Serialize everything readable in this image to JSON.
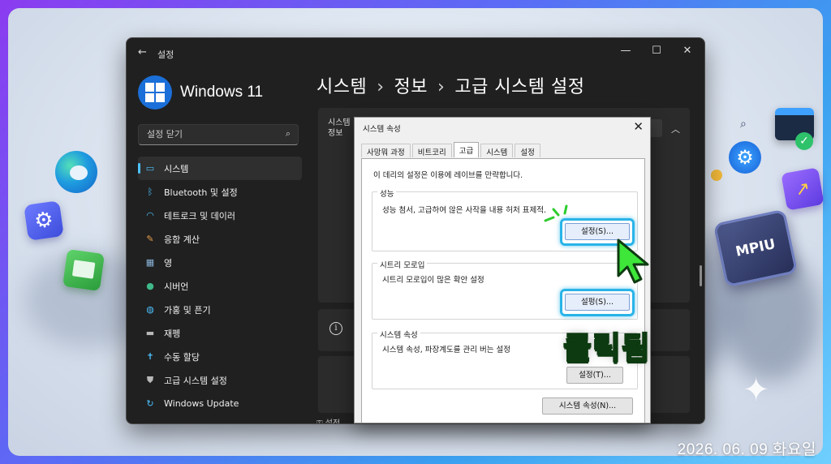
{
  "window": {
    "title": "설정",
    "brand": "Windows 11",
    "controls": [
      "—",
      "☐",
      "✕"
    ]
  },
  "search": {
    "placeholder": "설정 닫기"
  },
  "sidebar": {
    "items": [
      {
        "label": "시스템",
        "icon": "monitor-icon",
        "color": "#4cc2ff"
      },
      {
        "label": "Bluetooth 및 설정",
        "icon": "bluetooth-icon",
        "color": "#4cc2ff"
      },
      {
        "label": "테트로크 및 데이러",
        "icon": "wifi-icon",
        "color": "#4cc2ff"
      },
      {
        "label": "응함 계산",
        "icon": "brush-icon",
        "color": "#e8a04c"
      },
      {
        "label": "영",
        "icon": "apps-icon",
        "color": "#8ab4d8"
      },
      {
        "label": "시버언",
        "icon": "person-icon",
        "color": "#3fb98a"
      },
      {
        "label": "가홍 및 픈기",
        "icon": "globe-icon",
        "color": "#4cc2ff"
      },
      {
        "label": "재펭",
        "icon": "gamepad-icon",
        "color": "#b8b8b8"
      },
      {
        "label": "수동 할당",
        "icon": "accessibility-icon",
        "color": "#4cc2ff"
      },
      {
        "label": "고급 시스템 설정",
        "icon": "shield-icon",
        "color": "#b8b8b8"
      },
      {
        "label": "Windows Update",
        "icon": "update-icon",
        "color": "#4cc2ff"
      }
    ]
  },
  "breadcrumb": {
    "part1": "시스템",
    "part2": "정보",
    "part3": "고급 시스템 설정",
    "sep": "›"
  },
  "panel": {
    "label_line1": "시스템",
    "label_line2": "정보"
  },
  "footer_partial": "설정",
  "dialog": {
    "title": "시스템 속성",
    "tabs": [
      "사망뭐 과정",
      "비트코리",
      "고급",
      "시스템",
      "설정"
    ],
    "active_tab": "고급",
    "intro": "이 데리의 설정은 이용에 레이브를 만략합니다.",
    "groups": [
      {
        "title": "성능",
        "desc": "성능 첨서, 고급하여 않은 사작을 내용 허처 표제적.",
        "button": "설정(S)..."
      },
      {
        "title": "시트리 모로입",
        "desc": "시트리 모로입이 많은 확안 설정",
        "button": "설펑(S)..."
      },
      {
        "title": "시스템 속성",
        "desc": "시스템 속성, 파장계도를 관리 버는 설정",
        "button": "설정(T)..."
      }
    ],
    "bottom_button": "시스템 속성(N)..."
  },
  "overlay": {
    "clicked_label": "클릭됨",
    "chip_label": "MPIU",
    "date": "2026. 06. 09 화요일",
    "accent": "#3ee63a",
    "highlight": "#2ab4e8"
  }
}
